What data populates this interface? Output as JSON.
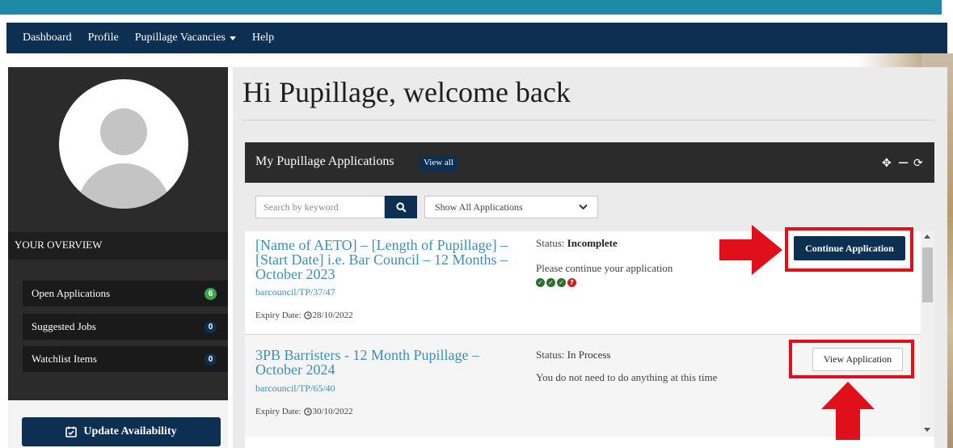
{
  "nav": {
    "items": [
      "Dashboard",
      "Profile",
      "Pupillage Vacancies",
      "Help"
    ]
  },
  "sidebar": {
    "overview_title": "YOUR OVERVIEW",
    "items": [
      {
        "label": "Open Applications",
        "count": "6"
      },
      {
        "label": "Suggested Jobs",
        "count": "0"
      },
      {
        "label": "Watchlist Items",
        "count": "0"
      }
    ],
    "update_button": "Update Availability"
  },
  "main": {
    "welcome": "Hi Pupillage, welcome back",
    "panel_title": "My Pupillage Applications",
    "view_all": "View all",
    "search_placeholder": "Search by keyword",
    "filter_selected": "Show All Applications"
  },
  "applications": [
    {
      "title": "[Name of AETO] – [Length of Pupillage] – [Start Date] i.e. Bar Council – 12 Months – October 2023",
      "ref": "barcouncil/TP/37/47",
      "expiry_label": "Expiry Date:",
      "expiry_date": "28/10/2022",
      "status_label": "Status:",
      "status": "Incomplete",
      "message": "Please continue your application",
      "action": "Continue Application"
    },
    {
      "title": "3PB Barristers - 12 Month Pupillage – October 2024",
      "ref": "barcouncil/TP/65/40",
      "expiry_label": "Expiry Date:",
      "expiry_date": "30/10/2022",
      "status_label": "Status:",
      "status": "In Process",
      "message": "You do not need to do anything at this time",
      "action": "View Application"
    }
  ],
  "colors": {
    "navy": "#0d2f52",
    "teal_band": "#1e8aa6",
    "highlight_red": "#e0101b",
    "link_blue": "#3d8fb3",
    "badge_green": "#3aa64a"
  }
}
